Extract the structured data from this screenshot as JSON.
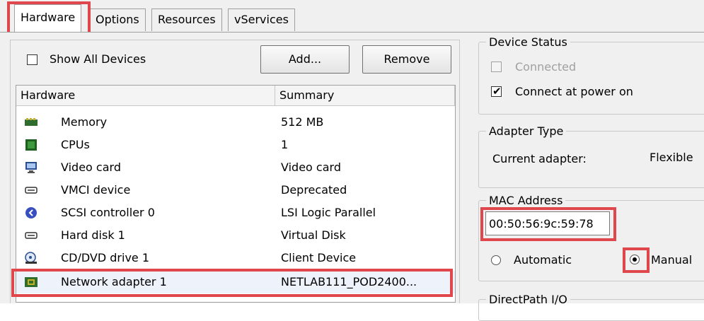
{
  "tabs": [
    {
      "label": "Hardware",
      "active": true
    },
    {
      "label": "Options"
    },
    {
      "label": "Resources"
    },
    {
      "label": "vServices"
    }
  ],
  "show_all_devices": {
    "label": "Show All Devices",
    "checked": false
  },
  "buttons": {
    "add": "Add...",
    "remove": "Remove"
  },
  "hardware_table": {
    "columns": [
      "Hardware",
      "Summary"
    ],
    "rows": [
      {
        "icon": "memory-icon",
        "name": "Memory",
        "summary": "512 MB"
      },
      {
        "icon": "cpu-icon",
        "name": "CPUs",
        "summary": "1"
      },
      {
        "icon": "monitor-icon",
        "name": "Video card",
        "summary": "Video card"
      },
      {
        "icon": "device-icon",
        "name": "VMCI device",
        "summary": "Deprecated"
      },
      {
        "icon": "scsi-icon",
        "name": "SCSI controller 0",
        "summary": "LSI Logic Parallel"
      },
      {
        "icon": "disk-icon",
        "name": "Hard disk 1",
        "summary": "Virtual Disk"
      },
      {
        "icon": "cdrom-icon",
        "name": "CD/DVD drive 1",
        "summary": "Client Device"
      },
      {
        "icon": "network-card-icon",
        "name": "Network adapter 1",
        "summary": "NETLAB111_POD2400...",
        "selected": true
      }
    ]
  },
  "device_status": {
    "title": "Device Status",
    "connected": {
      "label": "Connected",
      "checked": false,
      "disabled": true
    },
    "connect_at_power_on": {
      "label": "Connect at power on",
      "checked": true
    }
  },
  "adapter_type": {
    "title": "Adapter Type",
    "label": "Current adapter:",
    "value": "Flexible"
  },
  "mac_address": {
    "title": "MAC Address",
    "value": "00:50:56:9c:59:78",
    "options": [
      {
        "label": "Automatic",
        "selected": false
      },
      {
        "label": "Manual",
        "selected": true
      }
    ]
  },
  "directpath": {
    "title": "DirectPath I/O"
  },
  "colors": {
    "highlight": "#e0474c",
    "selected_row": "#eef3fb"
  }
}
